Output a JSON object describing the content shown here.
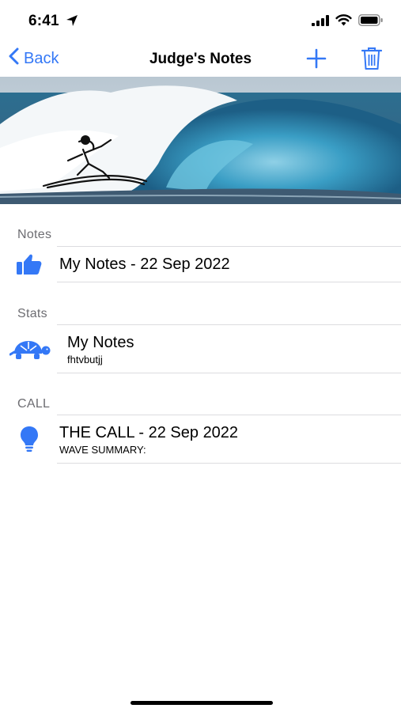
{
  "status_bar": {
    "time": "6:41",
    "icons": [
      "location-arrow-icon",
      "cellular-signal-icon",
      "wifi-icon",
      "battery-icon"
    ]
  },
  "nav": {
    "back_label": "Back",
    "title": "Judge's Notes",
    "add_icon": "plus-icon",
    "delete_icon": "trash-icon",
    "accent_color": "#3478f6"
  },
  "hero": {
    "description_icon": "wave-surfer-banner"
  },
  "sections": [
    {
      "header": "Notes",
      "rows": [
        {
          "icon": "thumbs-up-icon",
          "title": "My Notes - 22 Sep 2022",
          "subtitle": ""
        }
      ]
    },
    {
      "header": "Stats",
      "rows": [
        {
          "icon": "turtle-icon",
          "title": "My Notes",
          "subtitle": "fhtvbutjj"
        }
      ]
    },
    {
      "header": "CALL",
      "rows": [
        {
          "icon": "lightbulb-icon",
          "title": "THE CALL - 22 Sep 2022",
          "subtitle": "WAVE SUMMARY:"
        }
      ]
    }
  ]
}
